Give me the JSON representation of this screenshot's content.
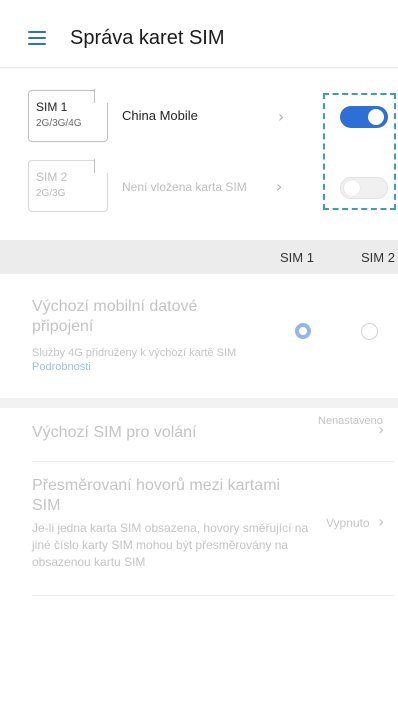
{
  "header": {
    "title": "Správa karet SIM"
  },
  "sims": [
    {
      "card_name": "SIM 1",
      "card_net": "2G/3G/4G",
      "label": "China Mobile",
      "enabled": true
    },
    {
      "card_name": "SIM 2",
      "card_net": "2G/3G",
      "label": "Není vložena karta SIM",
      "enabled": false
    }
  ],
  "columns": {
    "sim1": "SIM 1",
    "sim2": "SIM 2"
  },
  "data_connection": {
    "title": "Výchozí mobilní datové připojení",
    "subtitle": "Služby 4G přidruženy k výchozí kartě SIM",
    "link": "Podrobnosti",
    "selected": "SIM 1"
  },
  "call_sim": {
    "label": "Výchozí SIM pro volání",
    "value": "Nenastaveno"
  },
  "forwarding": {
    "title": "Přesměrovaní hovorů mezi kartami SIM",
    "subtitle": "Je-li jedna karta SIM obsazena, hovory směřující na jiné číslo karty SIM mohou být přesměrovány na obsazenou kartu SIM",
    "value": "Vypnuto"
  },
  "colors": {
    "accent": "#2e6fd6",
    "highlight_box": "#3a9fb0",
    "disabled_text": "#c4c4c4"
  },
  "icons": {
    "menu": "hamburger-menu-icon",
    "chevron": "chevron-right-icon"
  }
}
